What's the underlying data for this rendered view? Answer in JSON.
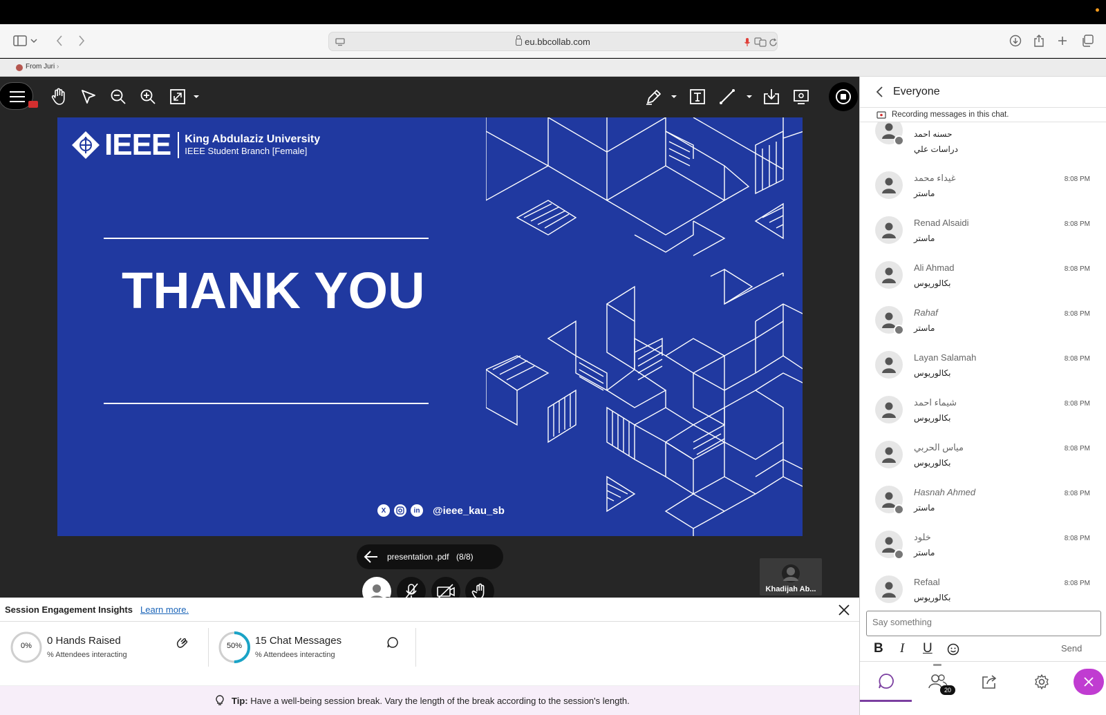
{
  "browser": {
    "url": "eu.bbcollab.com",
    "bookmark": "From Juri"
  },
  "slide": {
    "university": "King Abdulaziz University",
    "branch": "IEEE Student Branch [Female]",
    "logo_word": "IEEE",
    "heading": "THANK YOU",
    "handle": "@ieee_kau_sb"
  },
  "file": {
    "name": "presentation .pdf",
    "pages": "(8/8)"
  },
  "participant": {
    "name": "Khadijah Ab..."
  },
  "engagement": {
    "title": "Session Engagement Insights",
    "learn_more": "Learn more.",
    "hands": {
      "percent": "0%",
      "fraction": 0,
      "label": "0 Hands Raised",
      "sub": "% Attendees interacting"
    },
    "chat": {
      "percent": "50%",
      "fraction": 0.5,
      "label": "15 Chat Messages",
      "sub": "% Attendees interacting"
    },
    "tip_label": "Tip:",
    "tip_text": "Have a well-being session break. Vary the length of the break according to the session's length."
  },
  "chat": {
    "title": "Everyone",
    "recording_note": "Recording messages in this chat.",
    "messages": [
      {
        "name": "",
        "text": "حسنه احمد",
        "text2": "دراسات علي",
        "time": ""
      },
      {
        "name": "غيداء محمد",
        "text": "ماستر",
        "time": "8:08 PM"
      },
      {
        "name": "Renad Alsaidi",
        "text": "ماستر",
        "time": "8:08 PM"
      },
      {
        "name": "Ali Ahmad",
        "text": "بكالوريوس",
        "time": "8:08 PM"
      },
      {
        "name": "Rahaf",
        "text": "ماستر",
        "time": "8:08 PM"
      },
      {
        "name": "Layan Salamah",
        "text": "بكالوريوس",
        "time": "8:08 PM"
      },
      {
        "name": "شيماء احمد",
        "text": "بكالوريوس",
        "time": "8:08 PM"
      },
      {
        "name": "مياس الحربي",
        "text": "بكالوريوس",
        "time": "8:08 PM"
      },
      {
        "name": "Hasnah Ahmed",
        "text": "ماستر",
        "time": "8:08 PM"
      },
      {
        "name": "خلود",
        "text": "ماستر",
        "time": "8:08 PM"
      },
      {
        "name": "Refaal",
        "text": "بكالوريوس",
        "time": "8:08 PM"
      }
    ],
    "input_placeholder": "Say something",
    "send": "Send",
    "participants_count": "20"
  }
}
